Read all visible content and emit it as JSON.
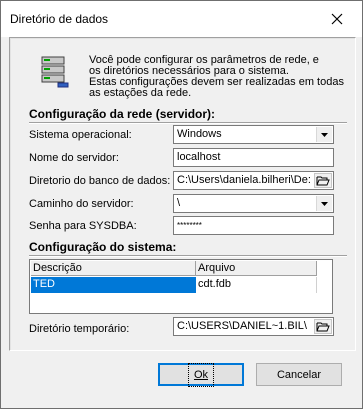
{
  "window": {
    "title": "Diretório de dados"
  },
  "info": {
    "lines": [
      "Você pode configurar os parâmetros de rede, e",
      "os diretórios necessários para o sistema.",
      "Estas configurações devem ser realizadas em todas",
      "as estações da rede."
    ]
  },
  "network": {
    "heading": "Configuração da rede (servidor):",
    "os_label": "Sistema operacional:",
    "os_value": "Windows",
    "server_label": "Nome do servidor:",
    "server_value": "localhost",
    "dbdir_label": "Diretorio do banco de dados:",
    "dbdir_value": "C:\\Users\\daniela.bilheri\\De:",
    "path_label": "Caminho do servidor:",
    "path_value": "\\",
    "pwd_label": "Senha para SYSDBA:",
    "pwd_value": "********"
  },
  "system": {
    "heading": "Configuração do sistema:",
    "columns": [
      "Descrição",
      "Arquivo"
    ],
    "rows": [
      [
        "TED",
        "cdt.fdb"
      ]
    ],
    "tempdir_label": "Diretório temporário:",
    "tempdir_value": "C:\\USERS\\DANIEL~1.BIL\\"
  },
  "buttons": {
    "ok": "Ok",
    "cancel": "Cancelar"
  },
  "icons": [
    "close-icon",
    "server-network-icon",
    "dropdown-arrow-icon",
    "folder-open-icon"
  ]
}
